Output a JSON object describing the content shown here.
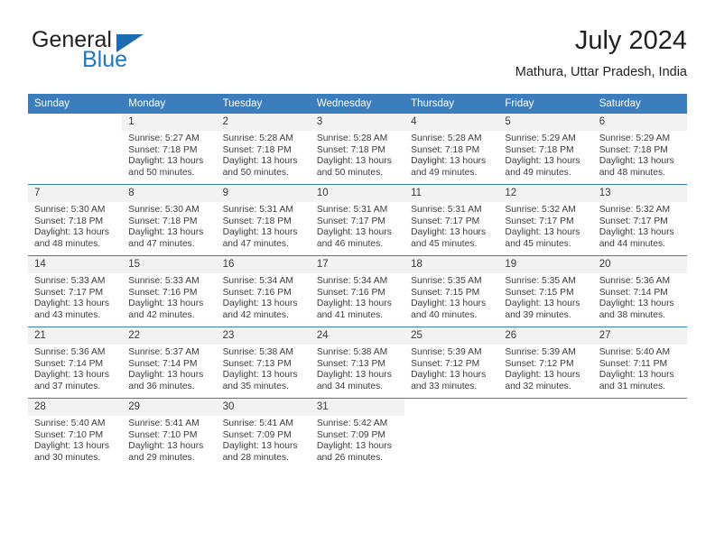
{
  "brand": {
    "name_part1": "General",
    "name_part2": "Blue",
    "logo_icon": "sail-triangle-icon"
  },
  "header": {
    "title": "July 2024",
    "subtitle": "Mathura, Uttar Pradesh, India"
  },
  "colors": {
    "header_blue": "#3b7dbd",
    "brand_blue": "#1b79c3",
    "daynum_bg": "#f2f2f2",
    "text": "#3b3b3b"
  },
  "weekdays": [
    "Sunday",
    "Monday",
    "Tuesday",
    "Wednesday",
    "Thursday",
    "Friday",
    "Saturday"
  ],
  "weeks": [
    [
      {
        "day": "",
        "sunrise": "",
        "sunset": "",
        "daylight_line1": "",
        "daylight_line2": ""
      },
      {
        "day": "1",
        "sunrise": "Sunrise: 5:27 AM",
        "sunset": "Sunset: 7:18 PM",
        "daylight_line1": "Daylight: 13 hours",
        "daylight_line2": "and 50 minutes."
      },
      {
        "day": "2",
        "sunrise": "Sunrise: 5:28 AM",
        "sunset": "Sunset: 7:18 PM",
        "daylight_line1": "Daylight: 13 hours",
        "daylight_line2": "and 50 minutes."
      },
      {
        "day": "3",
        "sunrise": "Sunrise: 5:28 AM",
        "sunset": "Sunset: 7:18 PM",
        "daylight_line1": "Daylight: 13 hours",
        "daylight_line2": "and 50 minutes."
      },
      {
        "day": "4",
        "sunrise": "Sunrise: 5:28 AM",
        "sunset": "Sunset: 7:18 PM",
        "daylight_line1": "Daylight: 13 hours",
        "daylight_line2": "and 49 minutes."
      },
      {
        "day": "5",
        "sunrise": "Sunrise: 5:29 AM",
        "sunset": "Sunset: 7:18 PM",
        "daylight_line1": "Daylight: 13 hours",
        "daylight_line2": "and 49 minutes."
      },
      {
        "day": "6",
        "sunrise": "Sunrise: 5:29 AM",
        "sunset": "Sunset: 7:18 PM",
        "daylight_line1": "Daylight: 13 hours",
        "daylight_line2": "and 48 minutes."
      }
    ],
    [
      {
        "day": "7",
        "sunrise": "Sunrise: 5:30 AM",
        "sunset": "Sunset: 7:18 PM",
        "daylight_line1": "Daylight: 13 hours",
        "daylight_line2": "and 48 minutes."
      },
      {
        "day": "8",
        "sunrise": "Sunrise: 5:30 AM",
        "sunset": "Sunset: 7:18 PM",
        "daylight_line1": "Daylight: 13 hours",
        "daylight_line2": "and 47 minutes."
      },
      {
        "day": "9",
        "sunrise": "Sunrise: 5:31 AM",
        "sunset": "Sunset: 7:18 PM",
        "daylight_line1": "Daylight: 13 hours",
        "daylight_line2": "and 47 minutes."
      },
      {
        "day": "10",
        "sunrise": "Sunrise: 5:31 AM",
        "sunset": "Sunset: 7:17 PM",
        "daylight_line1": "Daylight: 13 hours",
        "daylight_line2": "and 46 minutes."
      },
      {
        "day": "11",
        "sunrise": "Sunrise: 5:31 AM",
        "sunset": "Sunset: 7:17 PM",
        "daylight_line1": "Daylight: 13 hours",
        "daylight_line2": "and 45 minutes."
      },
      {
        "day": "12",
        "sunrise": "Sunrise: 5:32 AM",
        "sunset": "Sunset: 7:17 PM",
        "daylight_line1": "Daylight: 13 hours",
        "daylight_line2": "and 45 minutes."
      },
      {
        "day": "13",
        "sunrise": "Sunrise: 5:32 AM",
        "sunset": "Sunset: 7:17 PM",
        "daylight_line1": "Daylight: 13 hours",
        "daylight_line2": "and 44 minutes."
      }
    ],
    [
      {
        "day": "14",
        "sunrise": "Sunrise: 5:33 AM",
        "sunset": "Sunset: 7:17 PM",
        "daylight_line1": "Daylight: 13 hours",
        "daylight_line2": "and 43 minutes."
      },
      {
        "day": "15",
        "sunrise": "Sunrise: 5:33 AM",
        "sunset": "Sunset: 7:16 PM",
        "daylight_line1": "Daylight: 13 hours",
        "daylight_line2": "and 42 minutes."
      },
      {
        "day": "16",
        "sunrise": "Sunrise: 5:34 AM",
        "sunset": "Sunset: 7:16 PM",
        "daylight_line1": "Daylight: 13 hours",
        "daylight_line2": "and 42 minutes."
      },
      {
        "day": "17",
        "sunrise": "Sunrise: 5:34 AM",
        "sunset": "Sunset: 7:16 PM",
        "daylight_line1": "Daylight: 13 hours",
        "daylight_line2": "and 41 minutes."
      },
      {
        "day": "18",
        "sunrise": "Sunrise: 5:35 AM",
        "sunset": "Sunset: 7:15 PM",
        "daylight_line1": "Daylight: 13 hours",
        "daylight_line2": "and 40 minutes."
      },
      {
        "day": "19",
        "sunrise": "Sunrise: 5:35 AM",
        "sunset": "Sunset: 7:15 PM",
        "daylight_line1": "Daylight: 13 hours",
        "daylight_line2": "and 39 minutes."
      },
      {
        "day": "20",
        "sunrise": "Sunrise: 5:36 AM",
        "sunset": "Sunset: 7:14 PM",
        "daylight_line1": "Daylight: 13 hours",
        "daylight_line2": "and 38 minutes."
      }
    ],
    [
      {
        "day": "21",
        "sunrise": "Sunrise: 5:36 AM",
        "sunset": "Sunset: 7:14 PM",
        "daylight_line1": "Daylight: 13 hours",
        "daylight_line2": "and 37 minutes."
      },
      {
        "day": "22",
        "sunrise": "Sunrise: 5:37 AM",
        "sunset": "Sunset: 7:14 PM",
        "daylight_line1": "Daylight: 13 hours",
        "daylight_line2": "and 36 minutes."
      },
      {
        "day": "23",
        "sunrise": "Sunrise: 5:38 AM",
        "sunset": "Sunset: 7:13 PM",
        "daylight_line1": "Daylight: 13 hours",
        "daylight_line2": "and 35 minutes."
      },
      {
        "day": "24",
        "sunrise": "Sunrise: 5:38 AM",
        "sunset": "Sunset: 7:13 PM",
        "daylight_line1": "Daylight: 13 hours",
        "daylight_line2": "and 34 minutes."
      },
      {
        "day": "25",
        "sunrise": "Sunrise: 5:39 AM",
        "sunset": "Sunset: 7:12 PM",
        "daylight_line1": "Daylight: 13 hours",
        "daylight_line2": "and 33 minutes."
      },
      {
        "day": "26",
        "sunrise": "Sunrise: 5:39 AM",
        "sunset": "Sunset: 7:12 PM",
        "daylight_line1": "Daylight: 13 hours",
        "daylight_line2": "and 32 minutes."
      },
      {
        "day": "27",
        "sunrise": "Sunrise: 5:40 AM",
        "sunset": "Sunset: 7:11 PM",
        "daylight_line1": "Daylight: 13 hours",
        "daylight_line2": "and 31 minutes."
      }
    ],
    [
      {
        "day": "28",
        "sunrise": "Sunrise: 5:40 AM",
        "sunset": "Sunset: 7:10 PM",
        "daylight_line1": "Daylight: 13 hours",
        "daylight_line2": "and 30 minutes."
      },
      {
        "day": "29",
        "sunrise": "Sunrise: 5:41 AM",
        "sunset": "Sunset: 7:10 PM",
        "daylight_line1": "Daylight: 13 hours",
        "daylight_line2": "and 29 minutes."
      },
      {
        "day": "30",
        "sunrise": "Sunrise: 5:41 AM",
        "sunset": "Sunset: 7:09 PM",
        "daylight_line1": "Daylight: 13 hours",
        "daylight_line2": "and 28 minutes."
      },
      {
        "day": "31",
        "sunrise": "Sunrise: 5:42 AM",
        "sunset": "Sunset: 7:09 PM",
        "daylight_line1": "Daylight: 13 hours",
        "daylight_line2": "and 26 minutes."
      },
      {
        "day": "",
        "sunrise": "",
        "sunset": "",
        "daylight_line1": "",
        "daylight_line2": ""
      },
      {
        "day": "",
        "sunrise": "",
        "sunset": "",
        "daylight_line1": "",
        "daylight_line2": ""
      },
      {
        "day": "",
        "sunrise": "",
        "sunset": "",
        "daylight_line1": "",
        "daylight_line2": ""
      }
    ]
  ]
}
